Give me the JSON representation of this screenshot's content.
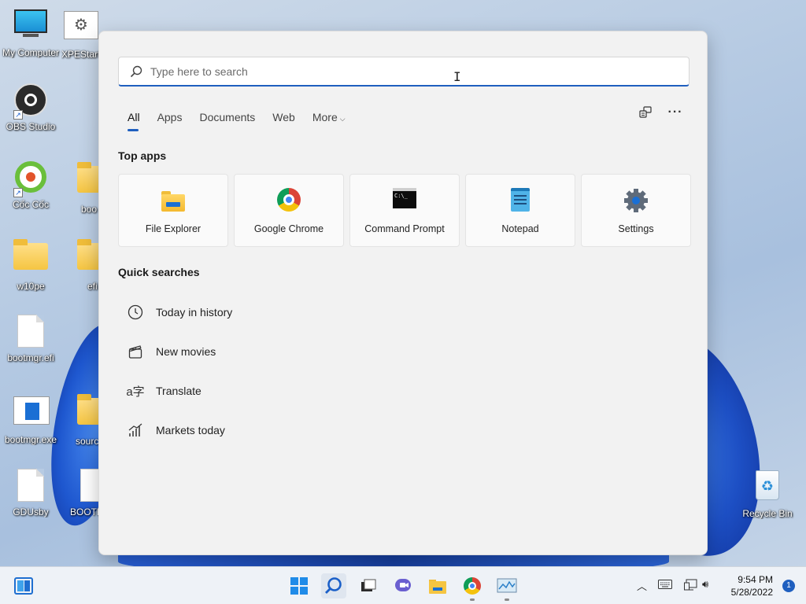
{
  "desktop": {
    "icons": [
      {
        "label": "My Computer"
      },
      {
        "label": "XPEStart"
      },
      {
        "label": "OBS Studio"
      },
      {
        "label": "Cốc Cốc"
      },
      {
        "label": "boo"
      },
      {
        "label": "w10pe"
      },
      {
        "label": "efi"
      },
      {
        "label": "bootmgr.efi"
      },
      {
        "label": "bootmgr.exe"
      },
      {
        "label": "sourc"
      },
      {
        "label": "GDUsby"
      },
      {
        "label": "BOOTM"
      },
      {
        "label": "Recycle Bin"
      }
    ]
  },
  "search": {
    "placeholder": "Type here to search",
    "value": ""
  },
  "tabs": [
    {
      "label": "All"
    },
    {
      "label": "Apps"
    },
    {
      "label": "Documents"
    },
    {
      "label": "Web"
    },
    {
      "label": "More"
    }
  ],
  "sections": {
    "top_apps": "Top apps",
    "quick_searches": "Quick searches"
  },
  "top_apps": [
    {
      "label": "File Explorer",
      "icon": "folder-icon"
    },
    {
      "label": "Google Chrome",
      "icon": "chrome-icon"
    },
    {
      "label": "Command Prompt",
      "icon": "cmd-icon"
    },
    {
      "label": "Notepad",
      "icon": "notepad-icon"
    },
    {
      "label": "Settings",
      "icon": "gear-icon"
    }
  ],
  "quick_searches": [
    {
      "label": "Today in history",
      "icon": "clock-icon"
    },
    {
      "label": "New movies",
      "icon": "clapperboard-icon"
    },
    {
      "label": "Translate",
      "icon": "translate-icon"
    },
    {
      "label": "Markets today",
      "icon": "chart-icon"
    }
  ],
  "taskbar": {
    "time": "9:54 PM",
    "date": "5/28/2022",
    "notification_count": "1",
    "accent": "#1f5fbf"
  }
}
